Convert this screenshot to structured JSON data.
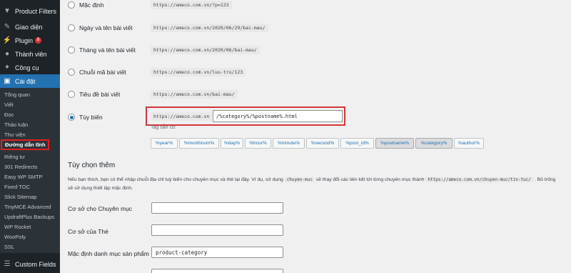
{
  "sidebar": {
    "top_items": [
      {
        "label": "Product Filters",
        "icon": "filter-icon"
      },
      {
        "label": "Giao diện",
        "icon": "brush-icon"
      },
      {
        "label": "Plugin",
        "icon": "plug-icon",
        "badge": "8"
      },
      {
        "label": "Thành viên",
        "icon": "user-icon"
      },
      {
        "label": "Công cụ",
        "icon": "wrench-icon"
      },
      {
        "label": "Cài đặt",
        "icon": "settings-icon"
      }
    ],
    "submenu": [
      "Tổng quan",
      "Viết",
      "Đọc",
      "Thảo luận",
      "Thư viện",
      "Đường dẫn tĩnh",
      "Riêng tư",
      "301 Redirects",
      "Easy WP SMTP",
      "Fixed TOC",
      "Slick Sitemap",
      "TinyMCE Advanced",
      "UpdraftPlus Backups",
      "WP Rocket",
      "WooPoly",
      "SSL"
    ],
    "bottom_item": {
      "label": "Custom Fields",
      "icon": "custom-fields-icon"
    },
    "active_submenu": "Đường dẫn tĩnh"
  },
  "permalinks": {
    "options": [
      {
        "label": "Mặc định",
        "example": "https://ameco.com.vn/?p=123"
      },
      {
        "label": "Ngày và tên bài viết",
        "example": "https://ameco.com.vn/2020/06/29/bai-mau/"
      },
      {
        "label": "Tháng và tên bài viết",
        "example": "https://ameco.com.vn/2020/06/bai-mau/"
      },
      {
        "label": "Chuỗi mã bài viết",
        "example": "https://ameco.com.vn/luu-tru/123"
      },
      {
        "label": "Tiêu đề bài viết",
        "example": "https://ameco.com.vn/bai-mau/"
      }
    ],
    "custom": {
      "label": "Tùy biến",
      "base": "https://ameco.com.vn",
      "value": "/%category%/%postname%.html"
    },
    "tags_label": "Tag sẵn có:",
    "tags": [
      "%year%",
      "%monthnum%",
      "%day%",
      "%hour%",
      "%minute%",
      "%second%",
      "%post_id%",
      "%postname%",
      "%category%",
      "%author%"
    ],
    "selected_tags": [
      "%postname%",
      "%category%"
    ]
  },
  "optional": {
    "heading": "Tùy chọn thêm",
    "desc_part1": "Nếu bạn thích, bạn có thể nhập chuỗi địa chỉ tuỳ biến cho chuyên mục và thẻ tại đây. Ví dụ, sử dụng",
    "desc_code1": "chuyen-muc",
    "desc_part2": "sẽ thay đổi các liên kết tới từng chuyên mục thành",
    "desc_code2": "https://ameco.com.vn/chuyen-muc/tin-tuc/",
    "desc_part3": ". Bỏ trống sẽ sử dụng thiết lập mặc định.",
    "fields": [
      {
        "label": "Cơ sở cho Chuyên mục",
        "value": ""
      },
      {
        "label": "Cơ sở của Thẻ",
        "value": ""
      },
      {
        "label": "Mặc định danh mục sản phẩm",
        "value": "product-category"
      },
      {
        "label": "",
        "value": ""
      }
    ]
  }
}
